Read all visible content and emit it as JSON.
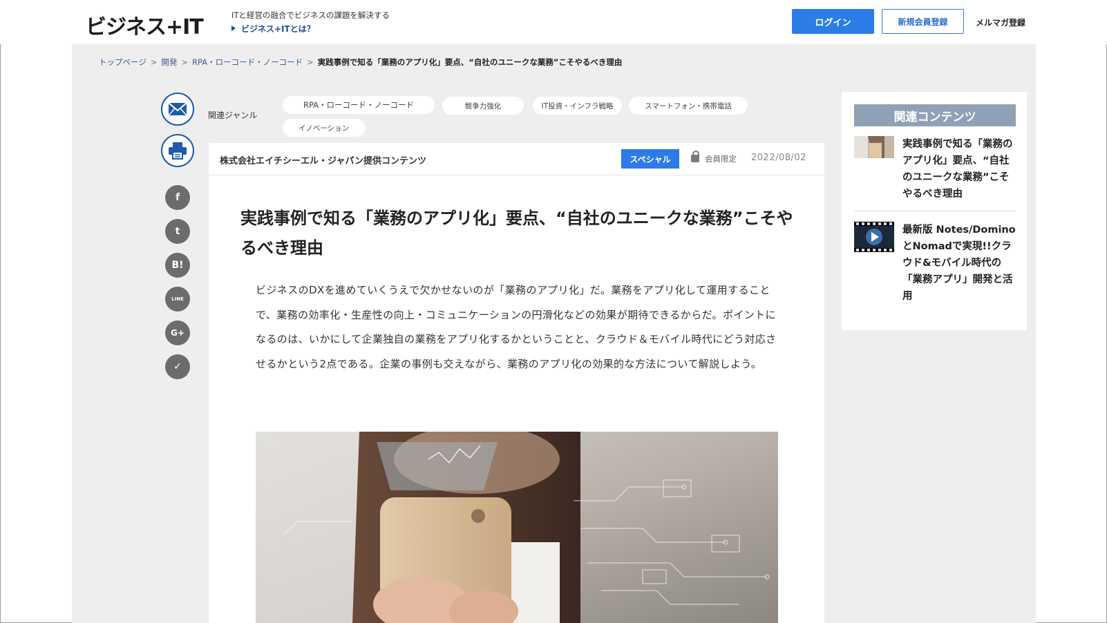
{
  "header": {
    "logo": "ビジネス+IT",
    "tagline": "ITと経営の融合でビジネスの課題を解決する",
    "whatis_link": "ビジネス+ITとは？",
    "login_label": "ログイン",
    "register_label": "新規会員登録",
    "mailmag_label": "メルマガ登録"
  },
  "breadcrumb": {
    "items": [
      "トップページ",
      "開発",
      "RPA・ローコード・ノーコード"
    ],
    "separator": ">",
    "current": "実践事例で知る「業務のアプリ化」要点、“自社のユニークな業務”こそやるべき理由"
  },
  "share": {
    "mail_icon": "mail-icon",
    "print_icon": "printer-icon",
    "social": [
      {
        "name": "facebook-icon",
        "glyph": "f"
      },
      {
        "name": "twitter-icon",
        "glyph": "t"
      },
      {
        "name": "hatena-bookmark-icon",
        "glyph": "B!"
      },
      {
        "name": "line-icon",
        "glyph": "LINE"
      },
      {
        "name": "google-plus-icon",
        "glyph": "G+"
      },
      {
        "name": "pocket-icon",
        "glyph": "✓"
      }
    ]
  },
  "genres": {
    "label": "関連ジャンル",
    "tags": [
      "RPA・ローコード・ノーコード",
      "競争力強化",
      "IT投資・インフラ戦略",
      "スマートフォン・携帯電話",
      "イノベーション"
    ]
  },
  "article": {
    "provider": "株式会社エイチシーエル・ジャパン提供コンテンツ",
    "badge": "スペシャル",
    "members_only": "会員限定",
    "date": "2022/08/02",
    "title": "実践事例で知る「業務のアプリ化」要点、“自社のユニークな業務”こそやるべき理由",
    "lead": "ビジネスのDXを進めていくうえで欠かせないのが「業務のアプリ化」だ。業務をアプリ化して運用することで、業務の効率化・生産性の向上・コミュニケーションの円滑化などの効果が期待できるからだ。ポイントになるのは、いかにして企業独自の業務をアプリ化するかということと、クラウド＆モバイル時代にどう対応させるかという2点である。企業の事例も交えながら、業務のアプリ化の効果的な方法について解説しよう。"
  },
  "related": {
    "heading": "関連コンテンツ",
    "items": [
      {
        "title": "実践事例で知る「業務のアプリ化」要点、“自社のユニークな業務”こそやるべき理由"
      },
      {
        "title": "最新版 Notes/DominoとNomadで実現!!クラウド&モバイル時代の「業務アプリ」開発と活用"
      }
    ]
  },
  "colors": {
    "brand_blue": "#2c7ee6",
    "link_blue": "#1a4fa8",
    "page_grey": "#eeeeee",
    "related_head": "#8fa1b5"
  }
}
